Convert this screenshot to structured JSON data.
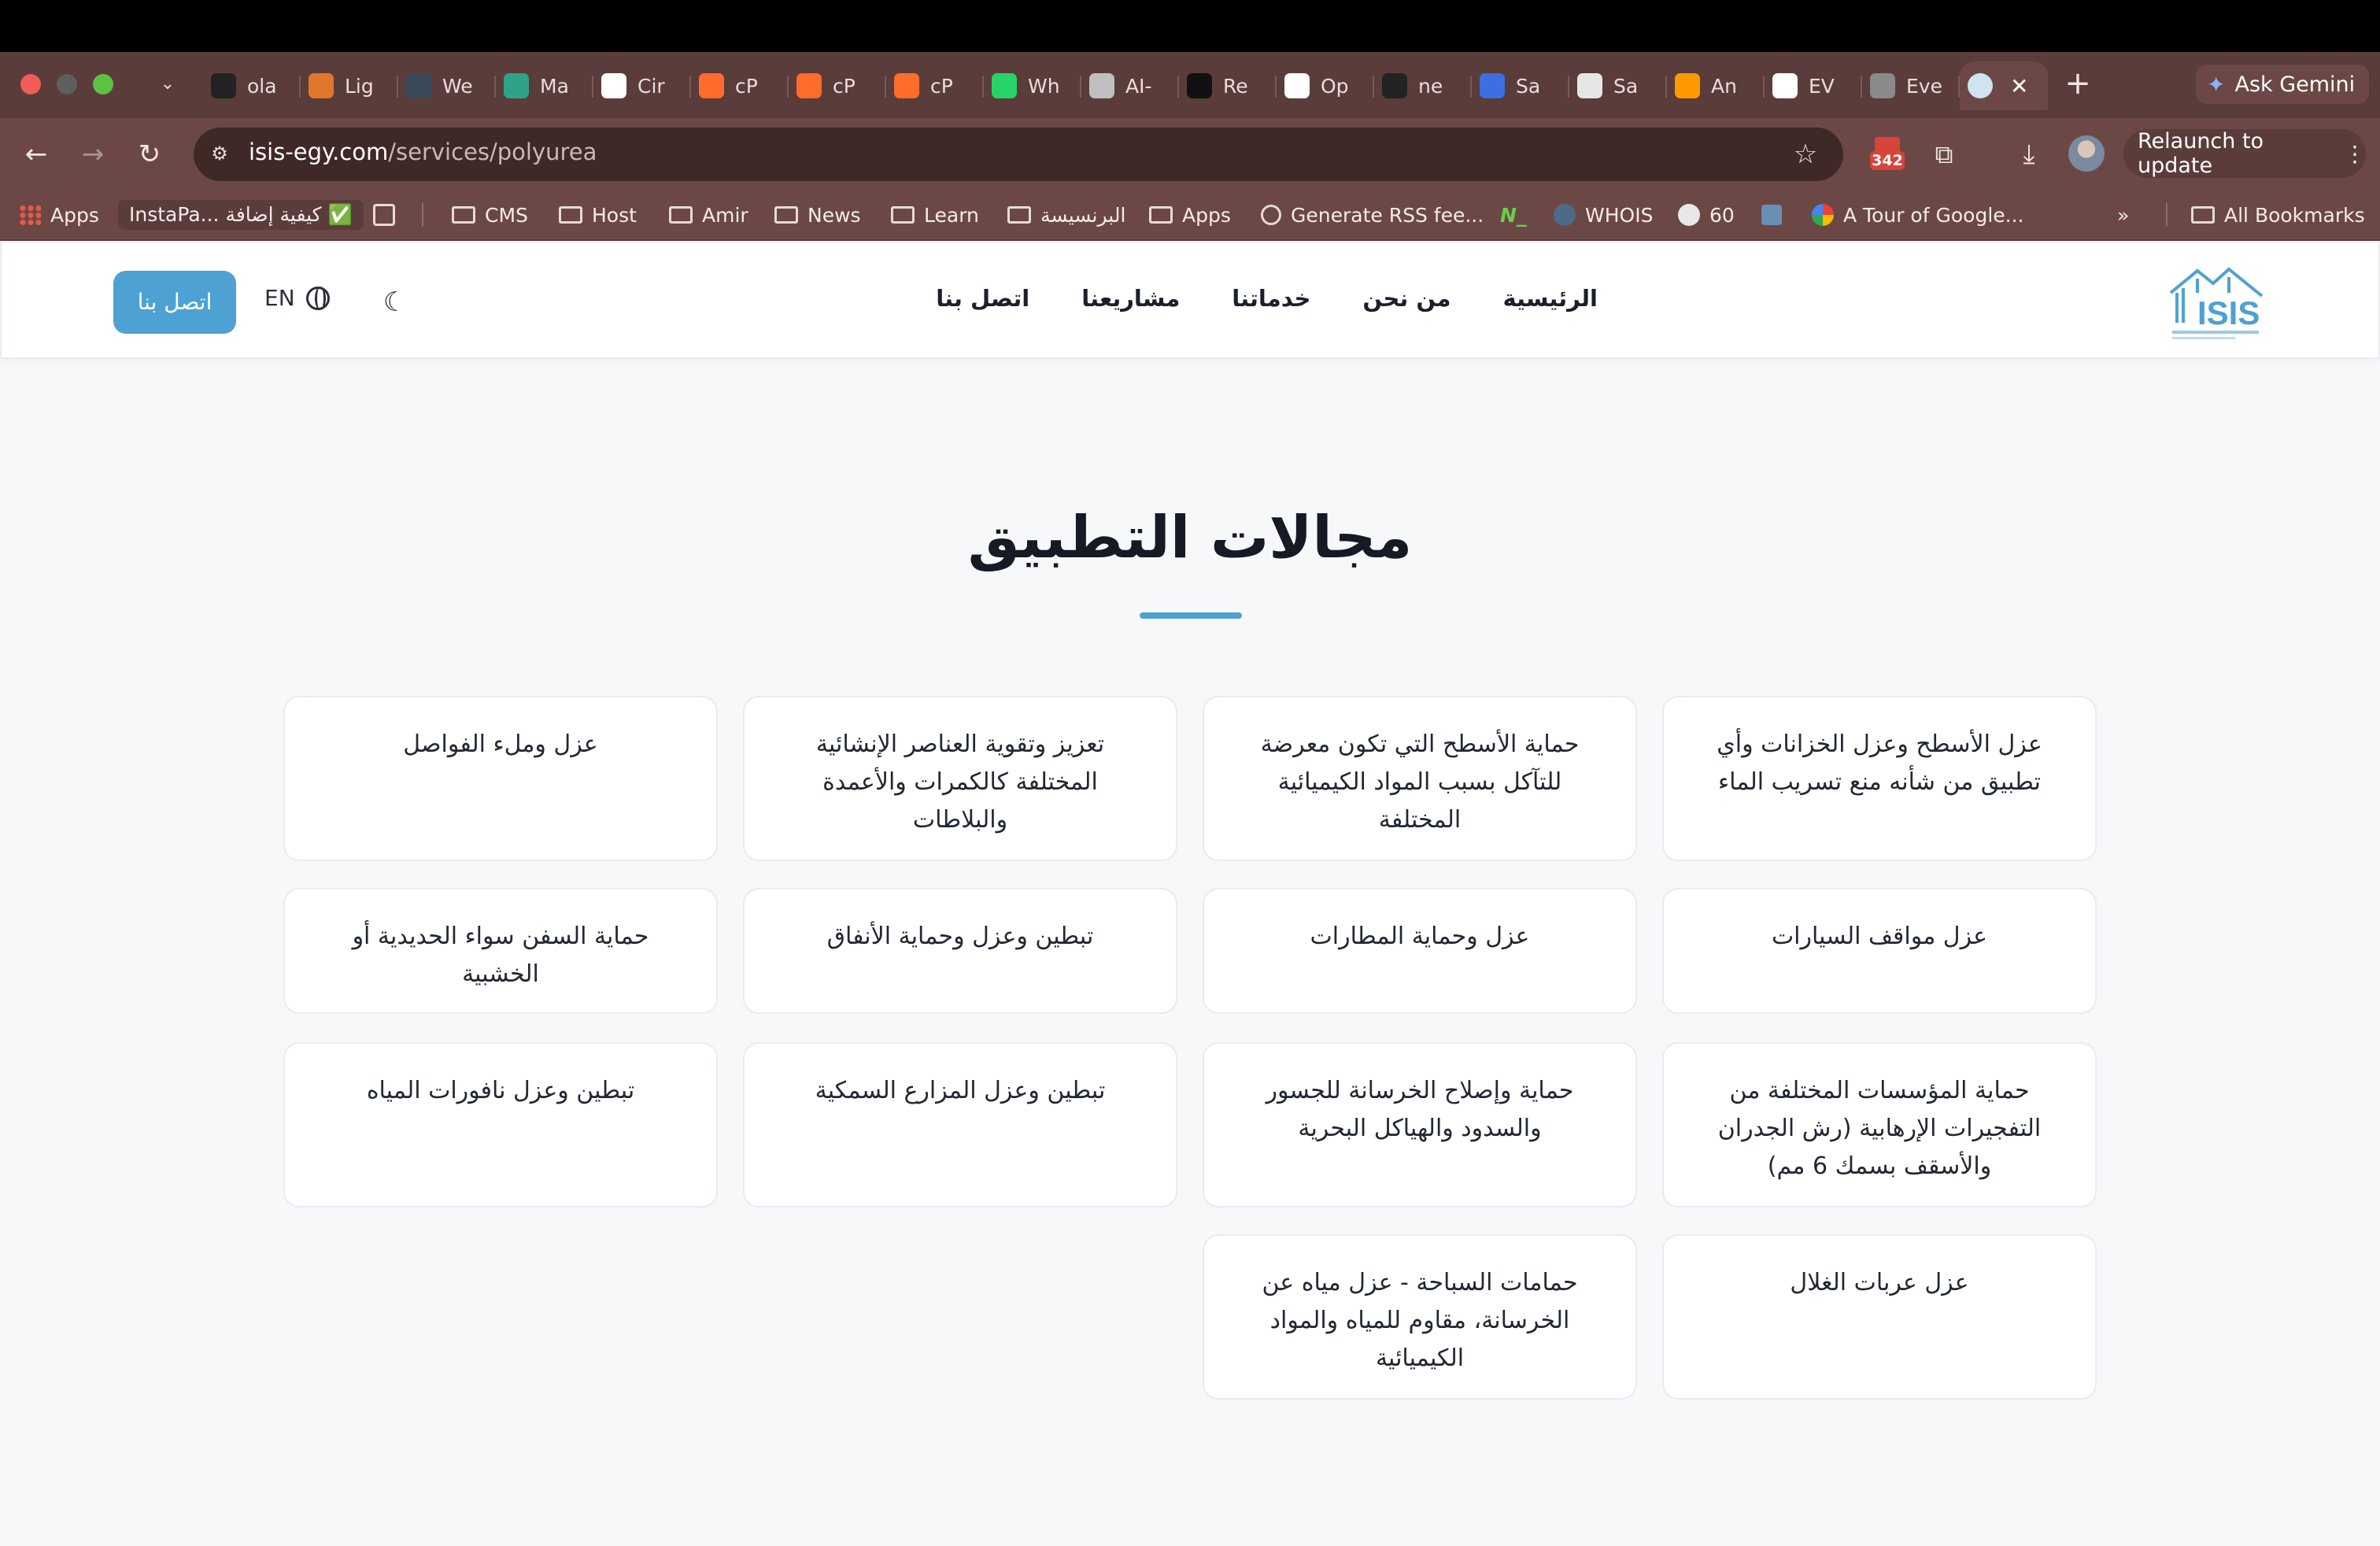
{
  "browser": {
    "tabs": [
      {
        "title": "ola",
        "icon": "github-icon",
        "color": "#222222"
      },
      {
        "title": "Lig",
        "icon": "lighthouse-icon",
        "color": "#e0772a"
      },
      {
        "title": "We",
        "icon": "web-icon",
        "color": "#3a4a5a"
      },
      {
        "title": "Ma",
        "icon": "h-icon",
        "color": "#2fa38a"
      },
      {
        "title": "Cir",
        "icon": "circle-icon",
        "color": "#ffffff"
      },
      {
        "title": "cP",
        "icon": "cpanel-icon",
        "color": "#ff6c2c"
      },
      {
        "title": "cP",
        "icon": "cpanel-icon",
        "color": "#ff6c2c"
      },
      {
        "title": "cP",
        "icon": "cpanel-icon",
        "color": "#ff6c2c"
      },
      {
        "title": "Wh",
        "icon": "whatsapp-icon",
        "color": "#25d366"
      },
      {
        "title": "AI-",
        "icon": "ai-icon",
        "color": "#bfbfbf"
      },
      {
        "title": "Re",
        "icon": "re-icon",
        "color": "#111111"
      },
      {
        "title": "Op",
        "icon": "openai-icon",
        "color": "#ffffff"
      },
      {
        "title": "ne",
        "icon": "github-icon",
        "color": "#222222"
      },
      {
        "title": "Sa",
        "icon": "sa-icon",
        "color": "#3d6fe0"
      },
      {
        "title": "Sa",
        "icon": "sa-icon",
        "color": "#e6e6e6"
      },
      {
        "title": "An",
        "icon": "amazon-icon",
        "color": "#ff9900"
      },
      {
        "title": "EV",
        "icon": "ev-icon",
        "color": "#ffffff"
      },
      {
        "title": "Eve",
        "icon": "eve-icon",
        "color": "#8a8a8a"
      }
    ],
    "ask_gemini": "Ask Gemini",
    "url_host": "isis-egy.com",
    "url_path": "/services/polyurea",
    "extension_badge": "342",
    "relaunch": "Relaunch to update",
    "bookmarks": {
      "apps": "Apps",
      "instapaper": "InstaPa... كيفية إضافة ✅",
      "folders": [
        "CMS",
        "Host",
        "Amir",
        "News",
        "Learn",
        "البرنسيسة",
        "Apps"
      ],
      "rss": "Generate RSS fee...",
      "whois": "WHOIS",
      "sixty": "60",
      "tour": "A Tour of Google...",
      "all": "All Bookmarks"
    }
  },
  "site": {
    "nav": {
      "home": "الرئيسية",
      "about": "من نحن",
      "services": "خدماتنا",
      "projects": "مشاريعنا",
      "contact": "اتصل بنا"
    },
    "lang": "EN",
    "cta": "اتصل بنا",
    "logo_text": "ISIS",
    "section_title": "مجالات التطبيق",
    "accent": "#4ea1d3",
    "cards": [
      "عزل الأسطح وعزل الخزانات وأي تطبيق من شأنه منع تسريب الماء",
      "حماية الأسطح التي تكون معرضة للتآكل بسبب المواد الكيميائية المختلفة",
      "تعزيز وتقوية العناصر الإنشائية المختلفة كالكمرات والأعمدة والبلاطات",
      "عزل وملء الفواصل",
      "عزل مواقف السيارات",
      "عزل وحماية المطارات",
      "تبطين وعزل وحماية الأنفاق",
      "حماية السفن سواء الحديدية أو الخشبية",
      "حماية المؤسسات المختلفة من التفجيرات الإرهابية (رش الجدران والأسقف بسمك 6 مم)",
      "حماية وإصلاح الخرسانة للجسور والسدود والهياكل البحرية",
      "تبطين وعزل المزارع السمكية",
      "تبطين وعزل نافورات المياه",
      "عزل عربات الغلال",
      "حمامات السباحة - عزل مياه عن الخرسانة، مقاوم للمياه والمواد الكيميائية"
    ]
  }
}
